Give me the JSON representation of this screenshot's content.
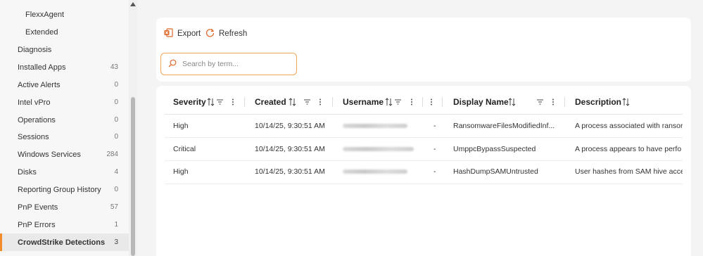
{
  "sidebar": {
    "items": [
      {
        "label": "FlexxAgent",
        "count": ""
      },
      {
        "label": "Extended",
        "count": ""
      },
      {
        "label": "Diagnosis",
        "count": ""
      },
      {
        "label": "Installed Apps",
        "count": "43"
      },
      {
        "label": "Active Alerts",
        "count": "0"
      },
      {
        "label": "Intel vPro",
        "count": "0"
      },
      {
        "label": "Operations",
        "count": "0"
      },
      {
        "label": "Sessions",
        "count": "0"
      },
      {
        "label": "Windows Services",
        "count": "284"
      },
      {
        "label": "Disks",
        "count": "4"
      },
      {
        "label": "Reporting Group History",
        "count": "0"
      },
      {
        "label": "PnP Events",
        "count": "57"
      },
      {
        "label": "PnP Errors",
        "count": "1"
      },
      {
        "label": "CrowdStrike Detections",
        "count": "3"
      }
    ]
  },
  "toolbar": {
    "export_label": "Export",
    "refresh_label": "Refresh"
  },
  "search": {
    "placeholder": "Search by term..."
  },
  "table": {
    "columns": [
      "Severity",
      "Created",
      "Username",
      "Display Name",
      "Description"
    ],
    "rows": [
      {
        "severity": "High",
        "created": "10/14/25, 9:30:51 AM",
        "dash": "-",
        "display_name": "RansomwareFilesModifiedInf...",
        "description": "A process associated with ransor"
      },
      {
        "severity": "Critical",
        "created": "10/14/25, 9:30:51 AM",
        "dash": "-",
        "display_name": "UmppcBypassSuspected",
        "description": "A process appears to have perfo"
      },
      {
        "severity": "High",
        "created": "10/14/25, 9:30:51 AM",
        "dash": "-",
        "display_name": "HashDumpSAMUntrusted",
        "description": "User hashes from SAM hive acce"
      }
    ]
  },
  "colors": {
    "accent": "#f28c28",
    "export_icon": "#e0682a"
  }
}
